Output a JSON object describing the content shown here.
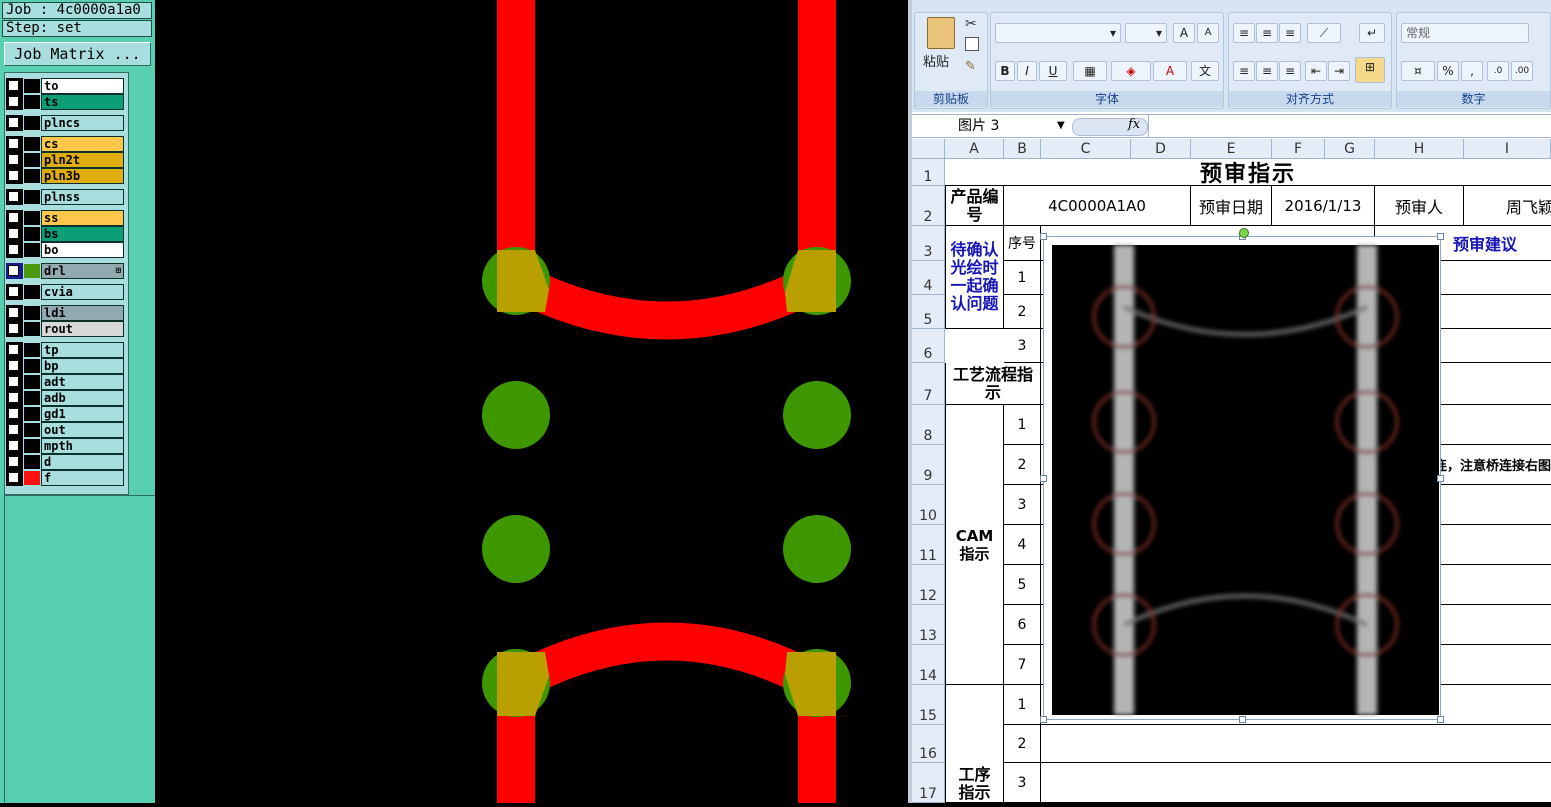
{
  "left_panel": {
    "job": "Job : 4c0000a1a0",
    "step": "Step: set",
    "job_matrix_label": "Job Matrix ...",
    "layers": [
      {
        "name": "to",
        "color": "#ffffff",
        "swatch": "#000000"
      },
      {
        "name": "ts",
        "color": "#0c9f77",
        "swatch": "#000000"
      },
      {
        "name": "plncs",
        "color": "#a8dede",
        "swatch": "#000000"
      },
      {
        "name": "cs",
        "color": "#ffc84c",
        "swatch": "#000000"
      },
      {
        "name": "pln2t",
        "color": "#e0ad10",
        "swatch": "#000000"
      },
      {
        "name": "pln3b",
        "color": "#e0ad10",
        "swatch": "#000000"
      },
      {
        "name": "plnss",
        "color": "#a8dede",
        "swatch": "#000000"
      },
      {
        "name": "ss",
        "color": "#ffc84c",
        "swatch": "#000000"
      },
      {
        "name": "bs",
        "color": "#0c9f77",
        "swatch": "#000000"
      },
      {
        "name": "bo",
        "color": "#ffffff",
        "swatch": "#000000"
      },
      {
        "name": "drl",
        "color": "#93a9b0",
        "swatch": "#4a9a10"
      },
      {
        "name": "cvia",
        "color": "#a8dede",
        "swatch": "#000000"
      },
      {
        "name": "ldi",
        "color": "#93a9b0",
        "swatch": "#000000"
      },
      {
        "name": "rout",
        "color": "#d8d8d8",
        "swatch": "#000000"
      },
      {
        "name": "tp",
        "color": "#a8dede",
        "swatch": "#000000"
      },
      {
        "name": "bp",
        "color": "#a8dede",
        "swatch": "#000000"
      },
      {
        "name": "adt",
        "color": "#a8dede",
        "swatch": "#000000"
      },
      {
        "name": "adb",
        "color": "#a8dede",
        "swatch": "#000000"
      },
      {
        "name": "gd1",
        "color": "#a8dede",
        "swatch": "#000000"
      },
      {
        "name": "out",
        "color": "#a8dede",
        "swatch": "#000000"
      },
      {
        "name": "mpth",
        "color": "#a8dede",
        "swatch": "#000000"
      },
      {
        "name": "d",
        "color": "#a8dede",
        "swatch": "#000000"
      },
      {
        "name": "f",
        "color": "#a8dede",
        "swatch": "#ff1010"
      }
    ]
  },
  "pcb": {
    "trace_color": "#ff0000",
    "pad_color": "#3f9700",
    "overlap_color": "#b9a000"
  },
  "excel": {
    "ribbon": {
      "paste_label": "粘贴",
      "clipboard_label": "剪贴板",
      "font_label": "字体",
      "align_label": "对齐方式",
      "number_label": "数字",
      "number_format": "常规"
    },
    "name_box": "图片 3",
    "fx": "fx",
    "columns": [
      "A",
      "B",
      "C",
      "D",
      "E",
      "F",
      "G",
      "H",
      "I"
    ],
    "rows": [
      "1",
      "2",
      "3",
      "4",
      "5",
      "6",
      "7",
      "8",
      "9",
      "10",
      "11",
      "12",
      "13",
      "14",
      "15",
      "16",
      "17"
    ],
    "sheet": {
      "title": "预审指示",
      "product_no_label": "产品编号",
      "product_no": "4C0000A1A0",
      "review_date_label": "预审日期",
      "review_date": "2016/1/13",
      "reviewer_label": "预审人",
      "reviewer": "周飞颖",
      "seq_label": "序号",
      "suggestion_label": "预审建议",
      "confirm_label": "待确认光绘时一起确认问题",
      "process_label": "工艺流程指示",
      "cam_label": "CAM指示",
      "procedure_label": "工序指示",
      "note_row9": "连，注意桥连接右图",
      "confirm_seq": [
        "1",
        "2",
        "3"
      ],
      "cam_seq": [
        "1",
        "2",
        "3",
        "4",
        "5",
        "6",
        "7"
      ],
      "procedure_seq": [
        "1",
        "2",
        "3"
      ]
    }
  }
}
